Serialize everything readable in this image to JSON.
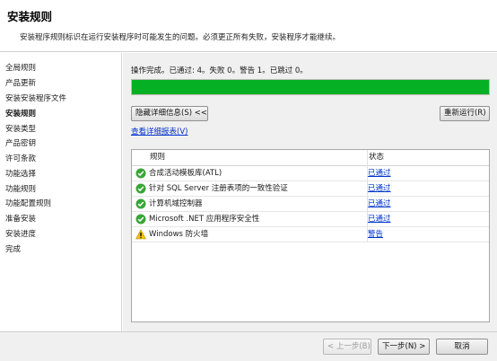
{
  "header": {
    "title": "安装规则",
    "subtitle": "安装程序规则标识在运行安装程序时可能发生的问题。必须更正所有失败，安装程序才能继续。"
  },
  "sidebar": {
    "items": [
      {
        "label": "全局规则",
        "active": false
      },
      {
        "label": "产品更新",
        "active": false
      },
      {
        "label": "安装安装程序文件",
        "active": false
      },
      {
        "label": "安装规则",
        "active": true
      },
      {
        "label": "安装类型",
        "active": false
      },
      {
        "label": "产品密钥",
        "active": false
      },
      {
        "label": "许可条款",
        "active": false
      },
      {
        "label": "功能选择",
        "active": false
      },
      {
        "label": "功能规则",
        "active": false
      },
      {
        "label": "功能配置规则",
        "active": false
      },
      {
        "label": "准备安装",
        "active": false
      },
      {
        "label": "安装进度",
        "active": false
      },
      {
        "label": "完成",
        "active": false
      }
    ]
  },
  "main": {
    "status_text": "操作完成。已通过: 4。失败 0。警告 1。已跳过 0。",
    "progress_fraction": 1.0,
    "progress_color": "#06b025",
    "hide_details_button": "隐藏详细信息(S) <<",
    "rerun_button": "重新运行(R)",
    "view_report_link": "查看详细报表(V)",
    "table": {
      "columns": [
        "规则",
        "状态"
      ],
      "rows": [
        {
          "icon": "check-circle-icon",
          "rule": "合成活动模板库(ATL)",
          "status": "已通过"
        },
        {
          "icon": "check-circle-icon",
          "rule": "针对 SQL Server 注册表项的一致性验证",
          "status": "已通过"
        },
        {
          "icon": "check-circle-icon",
          "rule": "计算机域控制器",
          "status": "已通过"
        },
        {
          "icon": "check-circle-icon",
          "rule": "Microsoft .NET 应用程序安全性",
          "status": "已通过"
        },
        {
          "icon": "warning-triangle-icon",
          "rule": "Windows 防火墙",
          "status": "警告"
        }
      ]
    }
  },
  "footer": {
    "back_button": "< 上一步(B)",
    "next_button": "下一步(N) >",
    "cancel_button": "取消"
  },
  "colors": {
    "pass": "#3aa53a",
    "warning": "#f5c400",
    "link": "#0033cc"
  }
}
